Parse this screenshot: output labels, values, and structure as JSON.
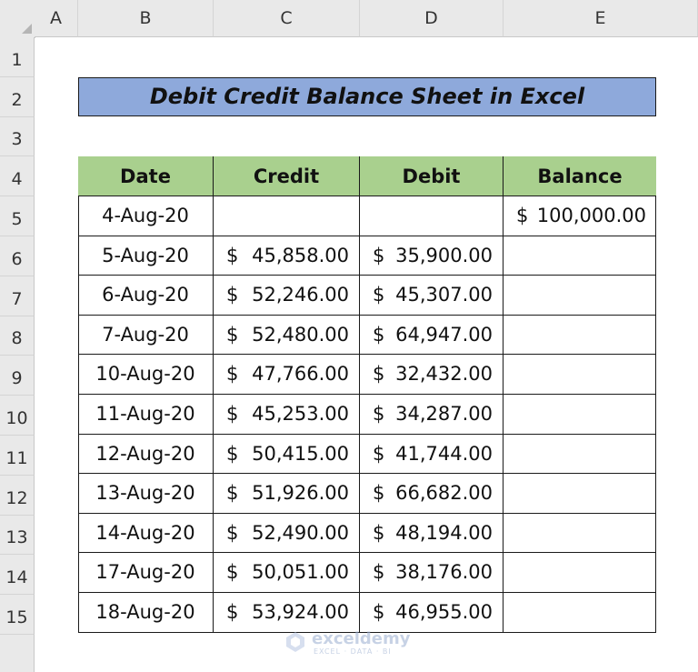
{
  "columns": [
    "A",
    "B",
    "C",
    "D",
    "E"
  ],
  "rows": [
    "1",
    "2",
    "3",
    "4",
    "5",
    "6",
    "7",
    "8",
    "9",
    "10",
    "11",
    "12",
    "13",
    "14",
    "15"
  ],
  "title": "Debit Credit Balance Sheet in Excel",
  "table": {
    "headers": [
      "Date",
      "Credit",
      "Debit",
      "Balance"
    ],
    "currency_symbol": "$",
    "records": [
      {
        "date": "4-Aug-20",
        "credit": "",
        "debit": "",
        "balance": "100,000.00"
      },
      {
        "date": "5-Aug-20",
        "credit": "45,858.00",
        "debit": "35,900.00",
        "balance": ""
      },
      {
        "date": "6-Aug-20",
        "credit": "52,246.00",
        "debit": "45,307.00",
        "balance": ""
      },
      {
        "date": "7-Aug-20",
        "credit": "52,480.00",
        "debit": "64,947.00",
        "balance": ""
      },
      {
        "date": "10-Aug-20",
        "credit": "47,766.00",
        "debit": "32,432.00",
        "balance": ""
      },
      {
        "date": "11-Aug-20",
        "credit": "45,253.00",
        "debit": "34,287.00",
        "balance": ""
      },
      {
        "date": "12-Aug-20",
        "credit": "50,415.00",
        "debit": "41,744.00",
        "balance": ""
      },
      {
        "date": "13-Aug-20",
        "credit": "51,926.00",
        "debit": "66,682.00",
        "balance": ""
      },
      {
        "date": "14-Aug-20",
        "credit": "52,490.00",
        "debit": "48,194.00",
        "balance": ""
      },
      {
        "date": "17-Aug-20",
        "credit": "50,051.00",
        "debit": "38,176.00",
        "balance": ""
      },
      {
        "date": "18-Aug-20",
        "credit": "53,924.00",
        "debit": "46,955.00",
        "balance": ""
      }
    ]
  },
  "watermark": {
    "name": "exceldemy",
    "tagline": "EXCEL · DATA · BI"
  },
  "colors": {
    "title_fill": "#8ea9db",
    "header_fill": "#a9d08e",
    "grid_header": "#e9e9e9"
  }
}
